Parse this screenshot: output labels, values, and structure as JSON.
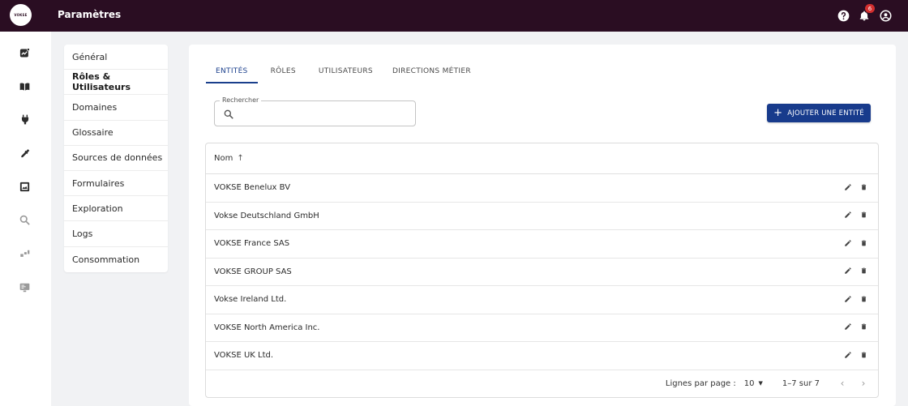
{
  "app": {
    "logo_text": "VOKSE",
    "title": "Paramètres",
    "notifications_count": "6"
  },
  "rail": {
    "icons": [
      "analytics-icon",
      "book-icon",
      "plug-icon",
      "eyedropper-icon",
      "image-gallery-icon",
      "search-icon",
      "dashboard-icon",
      "monitor-icon"
    ]
  },
  "menu": {
    "items": [
      {
        "label": "Général"
      },
      {
        "label": "Rôles & Utilisateurs",
        "active": true
      },
      {
        "label": "Domaines"
      },
      {
        "label": "Glossaire"
      },
      {
        "label": "Sources de données"
      },
      {
        "label": "Formulaires"
      },
      {
        "label": "Exploration"
      },
      {
        "label": "Logs"
      },
      {
        "label": "Consommation"
      }
    ]
  },
  "tabs": [
    {
      "label": "ENTITÉS",
      "active": true
    },
    {
      "label": "RÔLES"
    },
    {
      "label": "UTILISATEURS"
    },
    {
      "label": "DIRECTIONS MÉTIER"
    }
  ],
  "search": {
    "label": "Rechercher",
    "value": ""
  },
  "add_button": {
    "label": "AJOUTER UNE ENTITÉ"
  },
  "table": {
    "column_name": "Nom",
    "rows": [
      "VOKSE Benelux BV",
      "Vokse Deutschland GmbH",
      "VOKSE France SAS",
      "VOKSE GROUP SAS",
      "Vokse Ireland Ltd.",
      "VOKSE North America Inc.",
      "VOKSE UK Ltd."
    ]
  },
  "pagination": {
    "rows_per_page_label": "Lignes par page :",
    "rows_per_page": "10",
    "range": "1–7 sur 7"
  },
  "colors": {
    "topbar": "#2a0d22",
    "accent": "#183b8c",
    "badge": "#d32f2f"
  }
}
